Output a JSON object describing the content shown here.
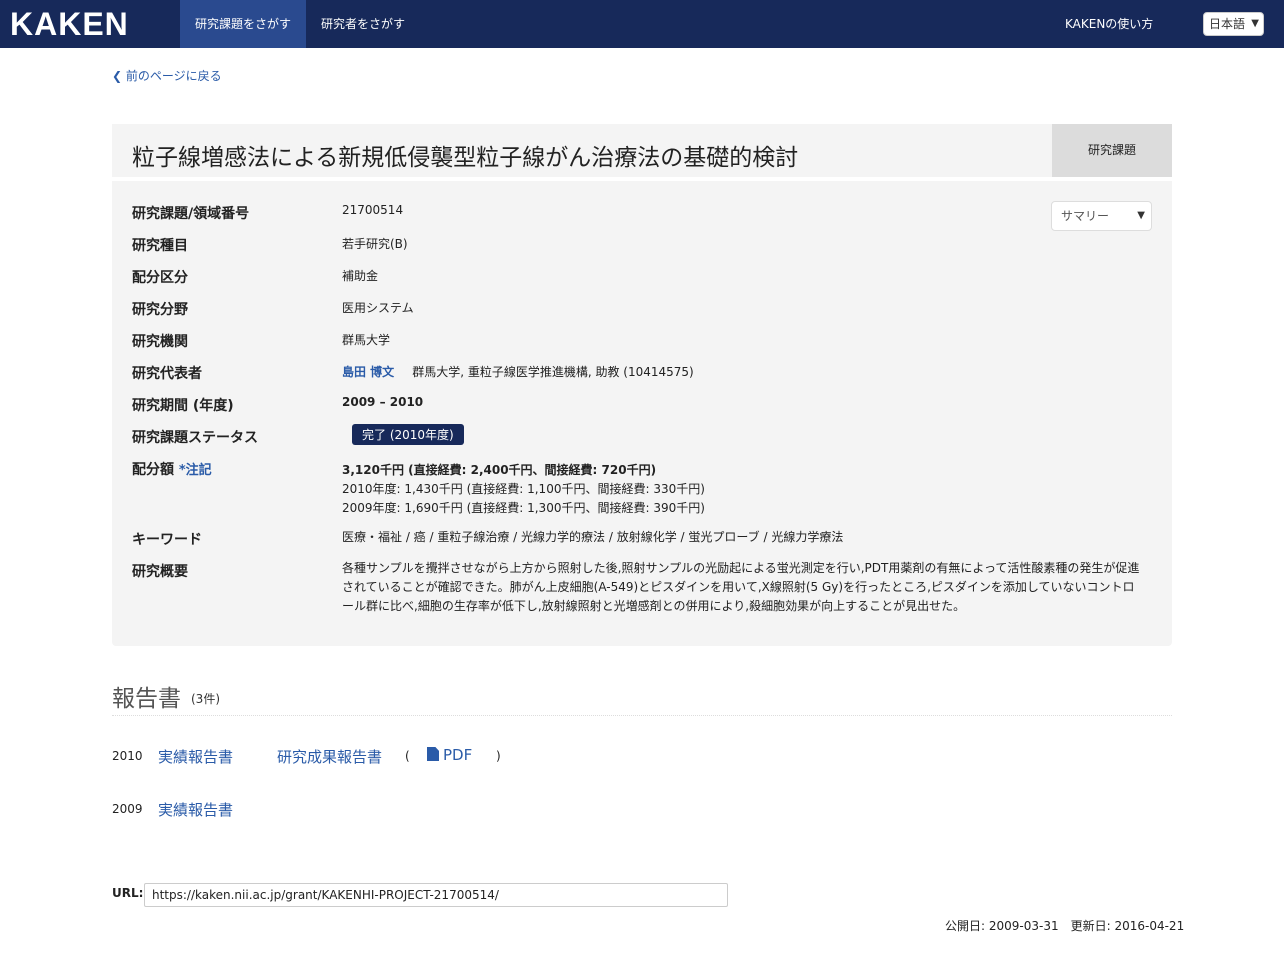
{
  "navbar": {
    "logo": "KAKEN",
    "items": [
      "研究課題をさがす",
      "研究者をさがす"
    ],
    "help": "KAKENの使い方",
    "language": "日本語"
  },
  "back_link": "前のページに戻る",
  "project": {
    "title": "粒子線増感法による新規低侵襲型粒子線がん治療法の基礎的検討",
    "type_badge": "研究課題",
    "view_select": "サマリー",
    "fields": {
      "number_label": "研究課題/領域番号",
      "number": "21700514",
      "category_label": "研究種目",
      "category": "若手研究(B)",
      "allocation_label": "配分区分",
      "allocation": "補助金",
      "field_label": "研究分野",
      "field": "医用システム",
      "institution_label": "研究機関",
      "institution": "群馬大学",
      "pi_label": "研究代表者",
      "pi_name": "島田 博文",
      "pi_affiliation": "群馬大学, 重粒子線医学推進機構, 助教 (10414575)",
      "period_label": "研究期間 (年度)",
      "period": "2009 – 2010",
      "status_label": "研究課題ステータス",
      "status": "完了 (2010年度)",
      "amount_label": "配分額",
      "amount_note": "*注記",
      "amount_total": "3,120千円 (直接経費: 2,400千円、間接経費: 720千円)",
      "amount_2010": "2010年度: 1,430千円 (直接経費: 1,100千円、間接経費: 330千円)",
      "amount_2009": "2009年度: 1,690千円 (直接経費: 1,300千円、間接経費: 390千円)",
      "keywords_label": "キーワード",
      "keywords": "医療・福祉 / 癌 / 重粒子線治療 / 光線力学的療法 / 放射線化学 / 蛍光プローブ / 光線力学療法",
      "abstract_label": "研究概要",
      "abstract": "各種サンプルを攪拌させながら上方から照射した後,照射サンプルの光励起による蛍光測定を行い,PDT用薬剤の有無によって活性酸素種の発生が促進されていることが確認できた。肺がん上皮細胞(A-549)とピスダインを用いて,X線照射(5 Gy)を行ったところ,ピスダインを添加していないコントロール群に比べ,細胞の生存率が低下し,放射線照射と光増感剤との併用により,殺細胞効果が向上することが見出せた。"
    }
  },
  "reports": {
    "title": "報告書",
    "count": "(3件)",
    "rows": [
      {
        "year": "2010",
        "links": [
          "実績報告書",
          "研究成果報告書"
        ],
        "paren_open": "(",
        "pdf": "PDF",
        "paren_close": ")"
      },
      {
        "year": "2009",
        "links": [
          "実績報告書"
        ]
      }
    ]
  },
  "url": {
    "label": "URL:",
    "value": "https://kaken.nii.ac.jp/grant/KAKENHI-PROJECT-21700514/"
  },
  "dates": {
    "published": "公開日: 2009-03-31",
    "updated": "更新日: 2016-04-21"
  }
}
